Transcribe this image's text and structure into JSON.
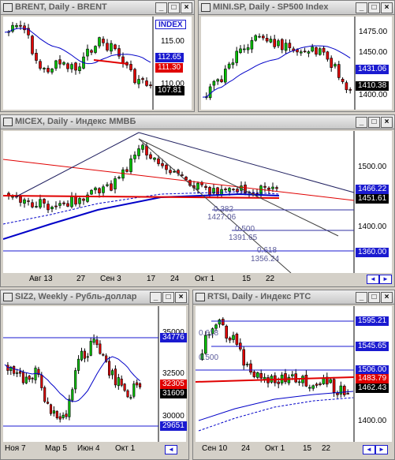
{
  "windows": {
    "brent": {
      "title": "BRENT, Daily - BRENT",
      "y_labels": [
        "115.00",
        "110.00"
      ],
      "index_label": "INDEX",
      "tags": [
        "112.65",
        "111.30",
        "107.81"
      ]
    },
    "mini": {
      "title": "MINI.SP, Daily - SP500 Index",
      "y_labels": [
        "1475.00",
        "1450.00",
        "1400.00"
      ],
      "tags": [
        "1431.06",
        "1410.38"
      ]
    },
    "micex": {
      "title": "MICEX, Daily - Индекс ММВБ",
      "y_labels": [
        "1500.00",
        "1400.00"
      ],
      "x_labels": [
        "Авг 13",
        "27",
        "Сен 3",
        "17",
        "24",
        "Окт 1",
        "15",
        "22"
      ],
      "tags": [
        "1466.22",
        "1451.61",
        "1360.00"
      ],
      "fib": [
        {
          "ratio": "0.382",
          "price": "1427.06"
        },
        {
          "ratio": "0.500",
          "price": "1391.65"
        },
        {
          "ratio": "0.618",
          "price": "1356.24"
        }
      ]
    },
    "siz2": {
      "title": "SIZ2, Weekly - Рубль-доллар",
      "y_labels": [
        "35000",
        "32500",
        "30000"
      ],
      "x_labels": [
        "Ноя 7",
        "Мар 5",
        "Июн 4",
        "Окт 1"
      ],
      "tags": [
        "34776",
        "32305",
        "31609",
        "29651"
      ]
    },
    "rtsi": {
      "title": "RTSI, Daily - Индекс РТС",
      "y_labels": [
        "1400.00"
      ],
      "x_labels": [
        "Сен 10",
        "24",
        "Окт 1",
        "15",
        "22"
      ],
      "tags": [
        "1595.21",
        "1545.65",
        "1506.00",
        "1483.79",
        "1462.43"
      ],
      "fib": [
        "0.618",
        "0.500"
      ]
    }
  },
  "window_buttons": {
    "minimize": "_",
    "maximize": "□",
    "close": "×"
  },
  "nav_buttons": {
    "left": "◄",
    "right": "►"
  },
  "colors": {
    "bull": "#00c000",
    "bear": "#e00000",
    "ma_blue": "#0000c8",
    "trend_red": "#e00000",
    "tag_blue": "#1a1ad0",
    "tag_red": "#e00000",
    "tag_black": "#000000"
  }
}
